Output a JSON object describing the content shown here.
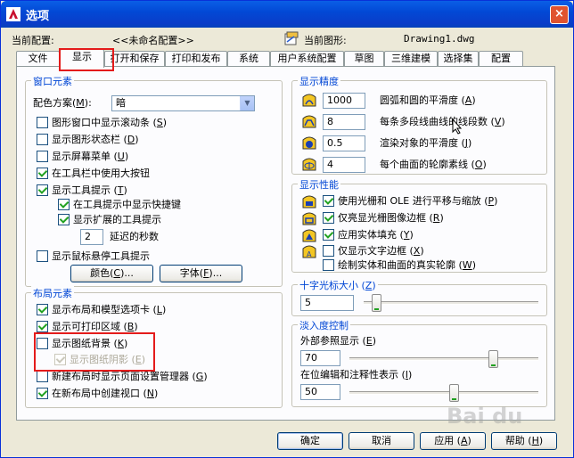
{
  "window": {
    "title": "选项",
    "close_glyph": "×"
  },
  "header": {
    "current_profile_label": "当前配置:",
    "current_profile_value": "<<未命名配置>>",
    "current_drawing_label": "当前图形:",
    "current_drawing_value": "Drawing1.dwg"
  },
  "tabs": [
    {
      "label": "文件"
    },
    {
      "label": "显示"
    },
    {
      "label": "打开和保存"
    },
    {
      "label": "打印和发布"
    },
    {
      "label": "系统"
    },
    {
      "label": "用户系统配置"
    },
    {
      "label": "草图"
    },
    {
      "label": "三维建模"
    },
    {
      "label": "选择集"
    },
    {
      "label": "配置"
    }
  ],
  "window_elements": {
    "title": "窗口元素",
    "color_scheme_label": "配色方案(",
    "color_scheme_key": "M",
    "color_scheme_close": "):",
    "color_scheme_value": "暗",
    "checkboxes": [
      {
        "label": "图形窗口中显示滚动条 (",
        "key": "S",
        "tail": ")",
        "checked": false
      },
      {
        "label": "显示图形状态栏 (",
        "key": "D",
        "tail": ")",
        "checked": false
      },
      {
        "label": "显示屏幕菜单 (",
        "key": "U",
        "tail": ")",
        "checked": false
      },
      {
        "label": "在工具栏中使用大按钮",
        "key": "",
        "tail": "",
        "checked": true
      },
      {
        "label": "显示工具提示 (",
        "key": "T",
        "tail": ")",
        "checked": true
      },
      {
        "label": "在工具提示中显示快捷键",
        "key": "",
        "tail": "",
        "checked": true
      },
      {
        "label": "显示扩展的工具提示",
        "key": "",
        "tail": "",
        "checked": true
      }
    ],
    "delay_value": "2",
    "delay_label": "延迟的秒数",
    "rollover_label": "显示鼠标悬停工具提示",
    "rollover_checked": false,
    "colors_button": "颜色(",
    "colors_key": "C",
    "colors_tail": ")...",
    "fonts_button": "字体(",
    "fonts_key": "F",
    "fonts_tail": ")..."
  },
  "layout_elements": {
    "title": "布局元素",
    "checkboxes": [
      {
        "label": "显示布局和模型选项卡 (",
        "key": "L",
        "tail": ")",
        "checked": true
      },
      {
        "label": "显示可打印区域 (",
        "key": "B",
        "tail": ")",
        "checked": true
      },
      {
        "label": "显示图纸背景 (",
        "key": "K",
        "tail": ")",
        "checked": false
      },
      {
        "label": "显示图纸阴影 (",
        "key": "E",
        "tail": ")",
        "checked": true,
        "disabled": true
      },
      {
        "label": "新建布局时显示页面设置管理器 (",
        "key": "G",
        "tail": ")",
        "checked": false
      },
      {
        "label": "在新布局中创建视口 (",
        "key": "N",
        "tail": ")",
        "checked": true
      }
    ]
  },
  "display_resolution": {
    "title": "显示精度",
    "items": [
      {
        "value": "1000",
        "label": "圆弧和圆的平滑度 (",
        "key": "A",
        "tail": ")"
      },
      {
        "value": "8",
        "label": "每条多段线曲线的线段数 (",
        "key": "V",
        "tail": ")"
      },
      {
        "value": "0.5",
        "label": "渲染对象的平滑度 (",
        "key": "J",
        "tail": ")"
      },
      {
        "value": "4",
        "label": "每个曲面的轮廓素线 (",
        "key": "O",
        "tail": ")"
      }
    ]
  },
  "display_performance": {
    "title": "显示性能",
    "items": [
      {
        "label": "使用光栅和 OLE 进行平移与缩放 (",
        "key": "P",
        "tail": ")",
        "checked": true,
        "icon": true
      },
      {
        "label": "仅亮显光栅图像边框 (",
        "key": "R",
        "tail": ")",
        "checked": true,
        "icon": true
      },
      {
        "label": "应用实体填充 (",
        "key": "Y",
        "tail": ")",
        "checked": true,
        "icon": true
      },
      {
        "label": "仅显示文字边框 (",
        "key": "X",
        "tail": ")",
        "checked": false,
        "icon": true
      },
      {
        "label": "绘制实体和曲面的真实轮廓 (",
        "key": "W",
        "tail": ")",
        "checked": false,
        "icon": false
      }
    ]
  },
  "crosshair": {
    "title_prefix": "十字光标大小 (",
    "title_key": "Z",
    "title_tail": ")",
    "value": "5",
    "level": 5
  },
  "fade": {
    "title": "淡入度控制",
    "xref_label": "外部参照显示 (",
    "xref_key": "E",
    "xref_tail": ")",
    "xref_value": "70",
    "xref_level": 70,
    "inplace_label": "在位编辑和注释性表示 (",
    "inplace_key": "I",
    "inplace_tail": ")",
    "inplace_value": "50",
    "inplace_level": 50
  },
  "buttons": {
    "ok": "确定",
    "cancel": "取消",
    "apply": "应用 (",
    "apply_key": "A",
    "apply_tail": ")",
    "help": "帮助 (",
    "help_key": "H",
    "help_tail": ")"
  },
  "watermark": "Bai du",
  "colors": {
    "accent": "#0046d5",
    "highlight": "#e41b1b",
    "title_bar": "#0249d6"
  }
}
